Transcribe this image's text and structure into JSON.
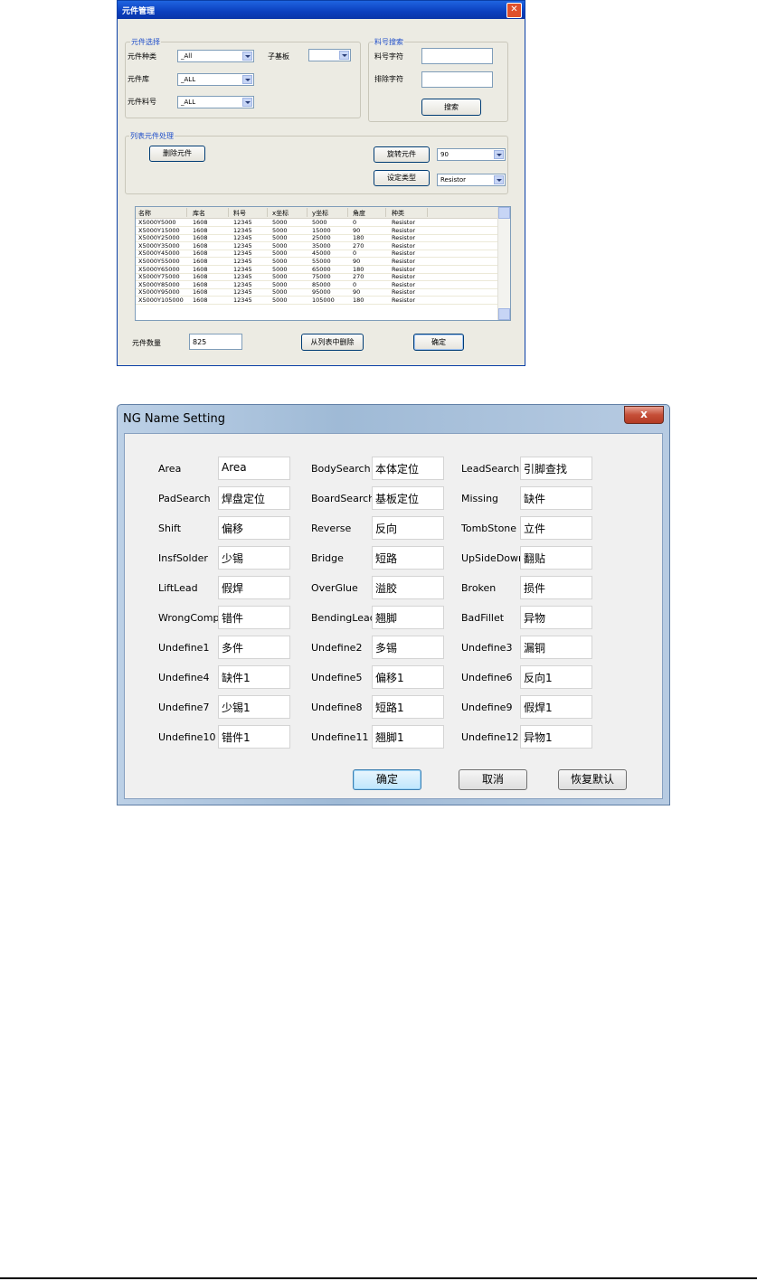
{
  "dialog1": {
    "title": "元件管理",
    "close_glyph": "✕",
    "selection": {
      "group_label": "元件选择",
      "type_label": "元件种类",
      "type_value": "_All",
      "base_label": "子基板",
      "base_value": "",
      "lib_label": "元件库",
      "lib_value": "_ALL",
      "part_label": "元件料号",
      "part_value": "_ALL"
    },
    "search": {
      "group_label": "料号搜索",
      "pn_label": "料号字符",
      "pn_value": "",
      "exclude_label": "排除字符",
      "exclude_value": "",
      "search_button": "搜索"
    },
    "list_proc": {
      "group_label": "列表元件处理",
      "delete_button": "删除元件",
      "rotate_button": "旋转元件",
      "rotate_value": "90",
      "type_button": "设定类型",
      "type_value": "Resistor"
    },
    "table": {
      "columns": [
        "名称",
        "库名",
        "料号",
        "x坐标",
        "y坐标",
        "角度",
        "种类"
      ],
      "rows": [
        [
          "X5000Y5000",
          "1608",
          "12345",
          "5000",
          "5000",
          "0",
          "Resistor"
        ],
        [
          "X5000Y15000",
          "1608",
          "12345",
          "5000",
          "15000",
          "90",
          "Resistor"
        ],
        [
          "X5000Y25000",
          "1608",
          "12345",
          "5000",
          "25000",
          "180",
          "Resistor"
        ],
        [
          "X5000Y35000",
          "1608",
          "12345",
          "5000",
          "35000",
          "270",
          "Resistor"
        ],
        [
          "X5000Y45000",
          "1608",
          "12345",
          "5000",
          "45000",
          "0",
          "Resistor"
        ],
        [
          "X5000Y55000",
          "1608",
          "12345",
          "5000",
          "55000",
          "90",
          "Resistor"
        ],
        [
          "X5000Y65000",
          "1608",
          "12345",
          "5000",
          "65000",
          "180",
          "Resistor"
        ],
        [
          "X5000Y75000",
          "1608",
          "12345",
          "5000",
          "75000",
          "270",
          "Resistor"
        ],
        [
          "X5000Y85000",
          "1608",
          "12345",
          "5000",
          "85000",
          "0",
          "Resistor"
        ],
        [
          "X5000Y95000",
          "1608",
          "12345",
          "5000",
          "95000",
          "90",
          "Resistor"
        ],
        [
          "X5000Y105000",
          "1608",
          "12345",
          "5000",
          "105000",
          "180",
          "Resistor"
        ]
      ]
    },
    "footer": {
      "count_label": "元件数量",
      "count_value": "825",
      "remove_button": "从列表中删除",
      "ok_button": "确定"
    }
  },
  "dialog2": {
    "title": "NG Name Setting",
    "close_glyph": "x",
    "fields": [
      {
        "label": "Area",
        "value": "Area"
      },
      {
        "label": "BodySearch",
        "value": "本体定位"
      },
      {
        "label": "LeadSearch",
        "value": "引脚查找"
      },
      {
        "label": "PadSearch",
        "value": "焊盘定位"
      },
      {
        "label": "BoardSearch",
        "value": "基板定位"
      },
      {
        "label": "Missing",
        "value": "缺件"
      },
      {
        "label": "Shift",
        "value": "偏移"
      },
      {
        "label": "Reverse",
        "value": "反向"
      },
      {
        "label": "TombStone",
        "value": "立件"
      },
      {
        "label": "InsfSolder",
        "value": "少锡"
      },
      {
        "label": "Bridge",
        "value": "短路"
      },
      {
        "label": "UpSideDown",
        "value": "翻贴"
      },
      {
        "label": "LiftLead",
        "value": "假焊"
      },
      {
        "label": "OverGlue",
        "value": "溢胶"
      },
      {
        "label": "Broken",
        "value": "损件"
      },
      {
        "label": "WrongComp",
        "value": "错件"
      },
      {
        "label": "BendingLead",
        "value": "翘脚"
      },
      {
        "label": "BadFillet",
        "value": "异物"
      },
      {
        "label": "Undefine1",
        "value": "多件"
      },
      {
        "label": "Undefine2",
        "value": "多锡"
      },
      {
        "label": "Undefine3",
        "value": "漏铜"
      },
      {
        "label": "Undefine4",
        "value": "缺件1"
      },
      {
        "label": "Undefine5",
        "value": "偏移1"
      },
      {
        "label": "Undefine6",
        "value": "反向1"
      },
      {
        "label": "Undefine7",
        "value": "少锡1"
      },
      {
        "label": "Undefine8",
        "value": "短路1"
      },
      {
        "label": "Undefine9",
        "value": "假焊1"
      },
      {
        "label": "Undefine10",
        "value": "错件1"
      },
      {
        "label": "Undefine11",
        "value": "翘脚1"
      },
      {
        "label": "Undefine12",
        "value": "异物1"
      }
    ],
    "buttons": {
      "ok": "确定",
      "cancel": "取消",
      "restore": "恢复默认"
    }
  }
}
